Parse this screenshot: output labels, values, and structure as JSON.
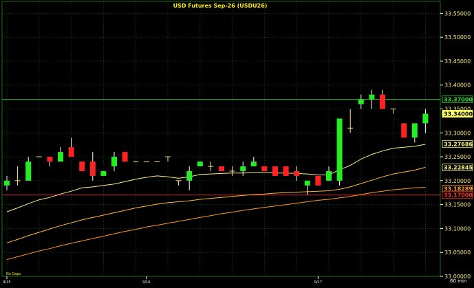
{
  "chart_data": {
    "type": "candlestick",
    "title": "USD Futures  Sep-26  (USDU26)",
    "timeframe_label": "60  min",
    "footer_note": "No  Gaps",
    "ylim": [
      33.0,
      33.575
    ],
    "y_ticks": [
      "33.00000",
      "33.05000",
      "33.10000",
      "33.15000",
      "33.20000",
      "33.25000",
      "33.30000",
      "33.35000",
      "33.40000",
      "33.45000",
      "33.50000",
      "33.55000"
    ],
    "grid": true,
    "reference_line": {
      "value": 33.37,
      "color": "#22bb22"
    },
    "support_line": {
      "value": 33.17,
      "color": "#cc2222"
    },
    "price_tags": [
      {
        "label": "33.37000",
        "value": 33.37,
        "bg": "#000000",
        "fg": "#33dd33",
        "border": "#33dd33"
      },
      {
        "label": "33.34000",
        "value": 33.34,
        "bg": "#ffff66",
        "fg": "#000000",
        "border": "#ffff66"
      },
      {
        "label": "33.27686",
        "value": 33.277,
        "bg": "#000000",
        "fg": "#ffff88",
        "border": "#ffff88"
      },
      {
        "label": "33.22845",
        "value": 33.228,
        "bg": "#000000",
        "fg": "#ffff88",
        "border": "#ffff88"
      },
      {
        "label": "33.18289",
        "value": 33.183,
        "bg": "#000000",
        "fg": "#ff9922",
        "border": "#ff9922"
      },
      {
        "label": "33.17000",
        "value": 33.17,
        "bg": "#000000",
        "fg": "#ff3333",
        "border": "#ff3333"
      }
    ],
    "x_labels": [
      {
        "label": "9/15",
        "i": 0
      },
      {
        "label": "9/16",
        "i": 13
      },
      {
        "label": "9/17",
        "i": 29
      }
    ],
    "candles": [
      {
        "o": 33.19,
        "h": 33.21,
        "l": 33.18,
        "c": 33.2
      },
      {
        "o": 33.2,
        "h": 33.23,
        "l": 33.19,
        "c": 33.2
      },
      {
        "o": 33.2,
        "h": 33.25,
        "l": 33.2,
        "c": 33.24
      },
      {
        "o": 33.25,
        "h": 33.25,
        "l": 33.25,
        "c": 33.25
      },
      {
        "o": 33.25,
        "h": 33.25,
        "l": 33.23,
        "c": 33.24
      },
      {
        "o": 33.24,
        "h": 33.27,
        "l": 33.24,
        "c": 33.26
      },
      {
        "o": 33.27,
        "h": 33.29,
        "l": 33.25,
        "c": 33.25
      },
      {
        "o": 33.24,
        "h": 33.24,
        "l": 33.22,
        "c": 33.22
      },
      {
        "o": 33.24,
        "h": 33.26,
        "l": 33.2,
        "c": 33.21
      },
      {
        "o": 33.21,
        "h": 33.22,
        "l": 33.21,
        "c": 33.22
      },
      {
        "o": 33.23,
        "h": 33.26,
        "l": 33.22,
        "c": 33.25
      },
      {
        "o": 33.26,
        "h": 33.26,
        "l": 33.24,
        "c": 33.24
      },
      {
        "o": 33.24,
        "h": 33.24,
        "l": 33.24,
        "c": 33.24
      },
      {
        "o": 33.24,
        "h": 33.24,
        "l": 33.24,
        "c": 33.24
      },
      {
        "o": 33.24,
        "h": 33.24,
        "l": 33.24,
        "c": 33.24
      },
      {
        "o": 33.25,
        "h": 33.25,
        "l": 33.24,
        "c": 33.25
      },
      {
        "o": 33.2,
        "h": 33.2,
        "l": 33.19,
        "c": 33.2
      },
      {
        "o": 33.2,
        "h": 33.23,
        "l": 33.18,
        "c": 33.22
      },
      {
        "o": 33.23,
        "h": 33.24,
        "l": 33.23,
        "c": 33.24
      },
      {
        "o": 33.23,
        "h": 33.24,
        "l": 33.22,
        "c": 33.23
      },
      {
        "o": 33.23,
        "h": 33.23,
        "l": 33.22,
        "c": 33.22
      },
      {
        "o": 33.22,
        "h": 33.23,
        "l": 33.21,
        "c": 33.22
      },
      {
        "o": 33.22,
        "h": 33.24,
        "l": 33.21,
        "c": 33.23
      },
      {
        "o": 33.23,
        "h": 33.25,
        "l": 33.23,
        "c": 33.24
      },
      {
        "o": 33.23,
        "h": 33.23,
        "l": 33.22,
        "c": 33.22
      },
      {
        "o": 33.23,
        "h": 33.23,
        "l": 33.21,
        "c": 33.21
      },
      {
        "o": 33.23,
        "h": 33.23,
        "l": 33.21,
        "c": 33.21
      },
      {
        "o": 33.22,
        "h": 33.23,
        "l": 33.2,
        "c": 33.21
      },
      {
        "o": 33.19,
        "h": 33.2,
        "l": 33.17,
        "c": 33.2
      },
      {
        "o": 33.21,
        "h": 33.21,
        "l": 33.19,
        "c": 33.19
      },
      {
        "o": 33.2,
        "h": 33.23,
        "l": 33.2,
        "c": 33.22
      },
      {
        "o": 33.2,
        "h": 33.33,
        "l": 33.19,
        "c": 33.33
      },
      {
        "o": 33.31,
        "h": 33.35,
        "l": 33.3,
        "c": 33.31
      },
      {
        "o": 33.36,
        "h": 33.38,
        "l": 33.35,
        "c": 33.37
      },
      {
        "o": 33.37,
        "h": 33.39,
        "l": 33.35,
        "c": 33.38
      },
      {
        "o": 33.38,
        "h": 33.39,
        "l": 33.35,
        "c": 33.35
      },
      {
        "o": 33.35,
        "h": 33.35,
        "l": 33.34,
        "c": 33.35
      },
      {
        "o": 33.32,
        "h": 33.32,
        "l": 33.29,
        "c": 33.29
      },
      {
        "o": 33.29,
        "h": 33.32,
        "l": 33.28,
        "c": 33.32
      },
      {
        "o": 33.32,
        "h": 33.35,
        "l": 33.3,
        "c": 33.34
      }
    ],
    "series": [
      {
        "name": "",
        "color": "#ffee88",
        "values": [
          33.135,
          33.143,
          33.152,
          33.16,
          33.165,
          33.172,
          33.178,
          33.185,
          33.187,
          33.19,
          33.193,
          33.198,
          33.203,
          33.207,
          33.21,
          33.208,
          33.205,
          33.208,
          33.213,
          33.214,
          33.215,
          33.216,
          33.216,
          33.217,
          33.217,
          33.216,
          33.216,
          33.215,
          33.214,
          33.212,
          33.212,
          33.223,
          33.232,
          33.245,
          33.255,
          33.262,
          33.268,
          33.27,
          33.272,
          33.276
        ]
      },
      {
        "name": "",
        "color": "#ffbb33",
        "values": [
          33.07,
          33.077,
          33.085,
          33.092,
          33.099,
          33.106,
          33.112,
          33.118,
          33.123,
          33.128,
          33.133,
          33.138,
          33.143,
          33.147,
          33.151,
          33.154,
          33.156,
          33.158,
          33.161,
          33.163,
          33.165,
          33.167,
          33.169,
          33.171,
          33.172,
          33.174,
          33.175,
          33.176,
          33.177,
          33.178,
          33.179,
          33.182,
          33.187,
          33.194,
          33.201,
          33.208,
          33.214,
          33.218,
          33.222,
          33.228
        ]
      },
      {
        "name": "",
        "color": "#ff9922",
        "values": [
          33.035,
          33.041,
          33.047,
          33.053,
          33.058,
          33.064,
          33.069,
          33.074,
          33.079,
          33.084,
          33.089,
          33.094,
          33.098,
          33.103,
          33.107,
          33.111,
          33.115,
          33.119,
          33.123,
          33.127,
          33.131,
          33.134,
          33.138,
          33.141,
          33.144,
          33.147,
          33.15,
          33.153,
          33.156,
          33.159,
          33.161,
          33.164,
          33.167,
          33.171,
          33.175,
          33.178,
          33.181,
          33.183,
          33.185,
          33.186
        ]
      }
    ]
  }
}
